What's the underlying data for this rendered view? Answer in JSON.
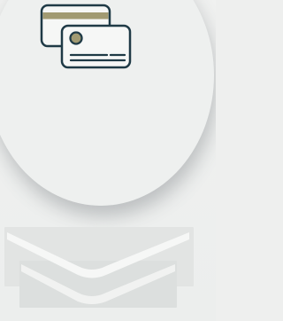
{
  "icon": {
    "name": "credit-cards-icon",
    "stroke_color": "#1f3a46",
    "stripe_color": "#a19a72",
    "chip_color": "#a19a72"
  },
  "circle": {
    "fill_color": "#eef0ef"
  },
  "chevrons": [
    {
      "name": "chevron-down-icon"
    },
    {
      "name": "chevron-down-icon"
    }
  ]
}
